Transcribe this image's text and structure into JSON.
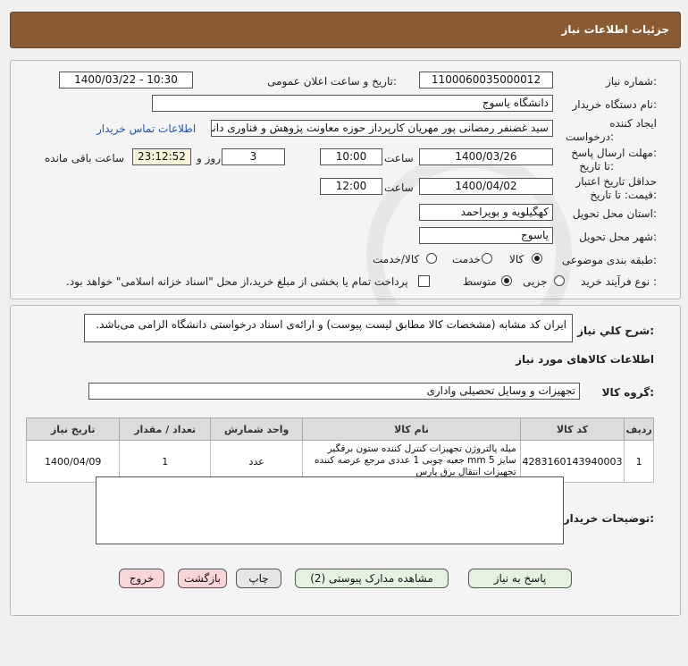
{
  "header": {
    "title": "جزئیات اطلاعات نیاز"
  },
  "form": {
    "need_number_label": "شماره نیاز:",
    "need_number": "1100060035000012",
    "announce_label": "تاریخ و ساعت اعلان عمومی:",
    "announce_value": "1400/03/22 - 10:30",
    "buyer_org_label": "نام دستگاه خریدار:",
    "buyer_org": "دانشگاه یاسوج",
    "creator_label_1": "ایجاد کننده",
    "creator_label_2": "درخواست:",
    "creator": "سید غضنفر رمضانی پور مهریان کارپرداز حوزه معاونت پژوهش و فناوری دانشگاه یاسوج",
    "contact_link": "اطلاعات تماس خریدار",
    "deadline_label_1": "مهلت ارسال پاسخ:",
    "deadline_label_2": "تا تاریخ:",
    "deadline_date": "1400/03/26",
    "time_label": "ساعت",
    "deadline_time": "10:00",
    "days_value": "3",
    "days_label": "روز و",
    "remaining_time": "23:12:52",
    "remaining_label": "ساعت باقی مانده",
    "validity_label_1": "حداقل تاریخ اعتبار",
    "validity_label_2": "قیمت: تا تاریخ:",
    "validity_date": "1400/04/02",
    "validity_time": "12:00",
    "province_label": "استان محل تحویل:",
    "province": "کهگیلویه و بویراحمد",
    "city_label": "شهر محل تحویل:",
    "city": "یاسوج",
    "category_label": "طبقه بندی موضوعی:",
    "category_options": [
      "کالا",
      "خدمت",
      "کالا/خدمت"
    ],
    "purchase_type_label": "نوع فرآیند خرید :",
    "purchase_options": [
      "جزیی",
      "متوسط"
    ],
    "payment_note": "پرداخت تمام یا بخشی از مبلغ خرید،از محل \"اسناد خزانه اسلامی\" خواهد بود."
  },
  "summary": {
    "label": "شرح کلي نياز:",
    "text": "ایران کد مشابه (مشخصات کالا مطابق لیست پیوست) و ارائه‌ی اسناد درخواستی دانشگاه الزامی می‌باشد."
  },
  "goods": {
    "section_title": "اطلاعات کالاهای مورد نیاز",
    "group_label": "گروه کالا:",
    "group_value": "تجهیزات و وسایل تحصیلی واداری",
    "columns": [
      "ردیف",
      "کد کالا",
      "نام کالا",
      "واحد شمارش",
      "تعداد / مقدار",
      "تاریخ نیاز"
    ],
    "rows": [
      {
        "row": "1",
        "code": "4283160143940003",
        "name": "میله پالتروژن تجهیزات کنترل کننده ستون برقگیر سایز 5 mm جعبه چوبی 1 عددی مرجع عرضه کننده تجهیزات انتقال برق پارس",
        "unit": "عدد",
        "qty": "1",
        "date": "1400/04/09"
      }
    ]
  },
  "buyer_notes": {
    "label": "توضیحات خریدار:",
    "text": ""
  },
  "buttons": {
    "reply": "پاسخ به نیاز",
    "attachments": "مشاهده مدارک پیوستی (2)",
    "print": "چاپ",
    "back": "بازگشت",
    "exit": "خروج"
  },
  "watermark": {
    "text": "ParsNamadData"
  }
}
